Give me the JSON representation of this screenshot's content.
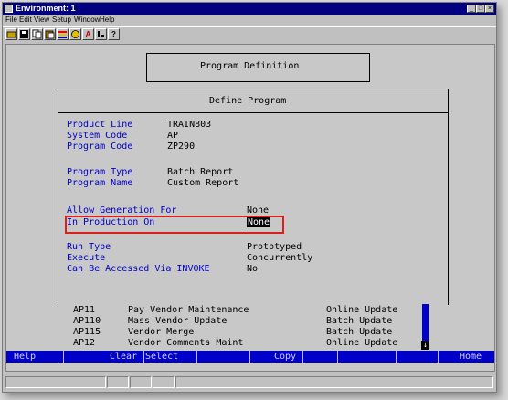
{
  "window": {
    "title": "Environment: 1"
  },
  "menubar": [
    "File",
    "Edit",
    "View",
    "Setup",
    "Window",
    "Help"
  ],
  "toolbar": {
    "icons": [
      "open-icon",
      "save-icon",
      "copy-icon",
      "paste-icon",
      "color-icon",
      "image-icon",
      "font-icon",
      "cursor-icon",
      "help-icon"
    ],
    "help_glyph": "?",
    "font_glyph": "A"
  },
  "screen": {
    "outer_title": "Program Definition",
    "inner_title": "Define Program",
    "fields": {
      "product_line": {
        "label": "Product Line",
        "value": "TRAIN803"
      },
      "system_code": {
        "label": "System Code",
        "value": "AP"
      },
      "program_code": {
        "label": "Program Code",
        "value": "ZP290"
      },
      "program_type": {
        "label": "Program Type",
        "value": "Batch Report"
      },
      "program_name": {
        "label": "Program Name",
        "value": "Custom Report"
      },
      "allow_generation": {
        "label": "Allow Generation For",
        "value": "None"
      },
      "in_production": {
        "label": "In Production On",
        "value": "None"
      },
      "run_type": {
        "label": "Run Type",
        "value": "Prototyped"
      },
      "execute": {
        "label": "Execute",
        "value": "Concurrently"
      },
      "invoke": {
        "label": "Can Be Accessed Via INVOKE",
        "value": "No"
      }
    },
    "list": [
      {
        "code": "AP11",
        "name": "Pay Vendor Maintenance",
        "type": "Online Update"
      },
      {
        "code": "AP110",
        "name": "Mass Vendor Update",
        "type": "Batch Update"
      },
      {
        "code": "AP115",
        "name": "Vendor Merge",
        "type": "Batch Update"
      },
      {
        "code": "AP12",
        "name": "Vendor Comments Maint",
        "type": "Online Update"
      }
    ],
    "fkeys": {
      "help": "Help",
      "clear": "Clear",
      "select": "Select",
      "copy": "Copy",
      "home": "Home"
    },
    "scroll_arrow": "↓"
  }
}
